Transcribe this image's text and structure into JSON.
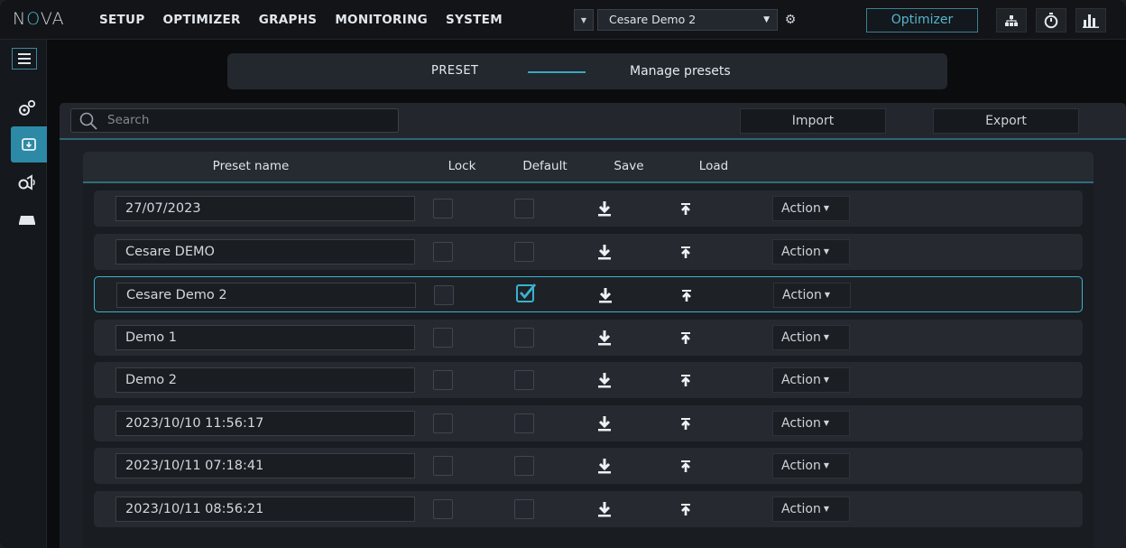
{
  "app": {
    "logo": "NOVA"
  },
  "nav": {
    "items": [
      "SETUP",
      "OPTIMIZER",
      "GRAPHS",
      "MONITORING",
      "SYSTEM"
    ]
  },
  "toolbar": {
    "preset_selected": "Cesare Demo 2",
    "optimizer_label": "Optimizer",
    "icons": [
      "hierarchy-icon",
      "stopwatch-icon",
      "bar-chart-icon"
    ]
  },
  "sidebar": {
    "items": [
      "gears-icon",
      "preset-download-icon",
      "speaker-icon",
      "device-icon"
    ],
    "active_index": 1
  },
  "header": {
    "section": "PRESET",
    "title": "Manage presets"
  },
  "search": {
    "placeholder": "Search"
  },
  "actions": {
    "import_label": "Import",
    "export_label": "Export"
  },
  "table": {
    "columns": {
      "name": "Preset name",
      "lock": "Lock",
      "default": "Default",
      "save": "Save",
      "load": "Load"
    },
    "action_label": "Action",
    "rows": [
      {
        "name": "27/07/2023",
        "lock": false,
        "default": false,
        "selected": false
      },
      {
        "name": "Cesare DEMO",
        "lock": false,
        "default": false,
        "selected": false
      },
      {
        "name": "Cesare Demo 2",
        "lock": false,
        "default": true,
        "selected": true
      },
      {
        "name": "Demo 1",
        "lock": false,
        "default": false,
        "selected": false
      },
      {
        "name": "Demo 2",
        "lock": false,
        "default": false,
        "selected": false
      },
      {
        "name": "2023/10/10 11:56:17",
        "lock": false,
        "default": false,
        "selected": false
      },
      {
        "name": "2023/10/11 07:18:41",
        "lock": false,
        "default": false,
        "selected": false
      },
      {
        "name": "2023/10/11 08:56:21",
        "lock": false,
        "default": false,
        "selected": false
      }
    ]
  },
  "colors": {
    "accent": "#3ab2cf",
    "active_sidebar": "#2c8aa6"
  }
}
